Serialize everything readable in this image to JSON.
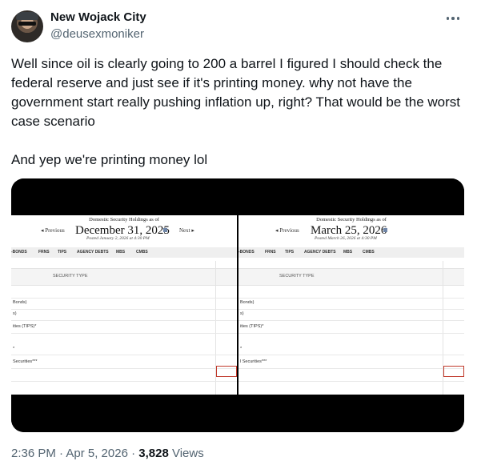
{
  "author": {
    "display_name": "New Wojack City",
    "handle": "@deusexmoniker"
  },
  "tweet": {
    "paragraph_1": "Well since oil is clearly going to 200 a barrel I figured I should check the federal reserve and just see if it's printing money.  why not have the government start really pushing inflation up, right?  That would be the worst case scenario",
    "paragraph_2": "And yep we're printing money lol"
  },
  "media": {
    "left": {
      "header": "Domestic Security Holdings as of",
      "date": "December 31, 2025",
      "posted": "Posted January 2, 2026 at 4:30 PM",
      "prev_label": "◂ Previous",
      "next_label": "Next ▸",
      "tabs": [
        "-BONDS",
        "FRNS",
        "TIPS",
        "AGENCY DEBTS",
        "MBS",
        "CMBS"
      ],
      "column_header": "SECURITY TYPE",
      "rows": [
        "Bonds)",
        "s)",
        "ities (TIPS)*",
        "*",
        "Securities***"
      ]
    },
    "right": {
      "header": "Domestic Security Holdings as of",
      "date": "March 25, 2026",
      "posted": "Posted March 26, 2026 at 4:30 PM",
      "prev_label": "◂ Previous",
      "tabs": [
        "-BONDS",
        "FRNS",
        "TIPS",
        "AGENCY DEBTS",
        "MBS",
        "CMBS"
      ],
      "column_header": "SECURITY TYPE",
      "rows": [
        "Bonds)",
        "s)",
        "ities (TIPS)*",
        "*",
        "l Securities***"
      ]
    }
  },
  "footer": {
    "timestamp": "2:36 PM · Apr 5, 2026 · ",
    "views_count": "3,828",
    "views_label": " Views"
  },
  "icons": {
    "more": "more-horizontal-icon",
    "calendar": "calendar-icon"
  },
  "colors": {
    "text_primary": "#0f1419",
    "text_secondary": "#536471",
    "highlight_box": "#c0392b"
  }
}
